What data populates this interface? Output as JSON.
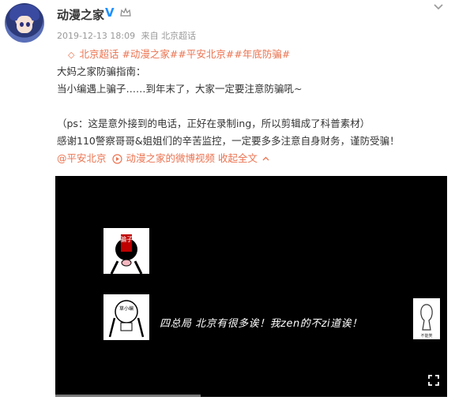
{
  "header": {
    "account_name": "动漫之家",
    "date": "2019-12-13 18:09",
    "source": "来自 北京超话"
  },
  "post": {
    "topic_tags": [
      "北京超话",
      "#动漫之家#",
      "#平安北京#",
      "#年底防骗#"
    ],
    "line1": "大妈之家防骗指南：",
    "line2": "当小编遇上骗子……到年末了，大家一定要注意防骗吼~",
    "line3": "（ps：这是意外接到的电话，正好在录制ing，所以剪辑成了科普素材）",
    "line4": "感谢110警察哥哥&姐姐们的辛苦监控，一定要多多注意自身财务，谨防受骗！",
    "mention": "@平安北京",
    "video_link": "动漫之家的微博视频",
    "collapse": "收起全文"
  },
  "video": {
    "label_scammer": "骗子",
    "label_editor": "草小编",
    "label_side": "不能笑",
    "subtitle": "四总局 北京有很多诶！我zen的不zi道诶！",
    "progress": 0.37
  },
  "icons": {
    "verified": "verified-v-icon",
    "crown": "crown-icon",
    "menu": "chevron-down-icon",
    "topic": "topic-icon",
    "video": "video-play-icon",
    "fullscreen": "fullscreen-icon"
  },
  "colors": {
    "link": "#eb7350",
    "verified": "#1e90ff",
    "meta": "#999999"
  }
}
